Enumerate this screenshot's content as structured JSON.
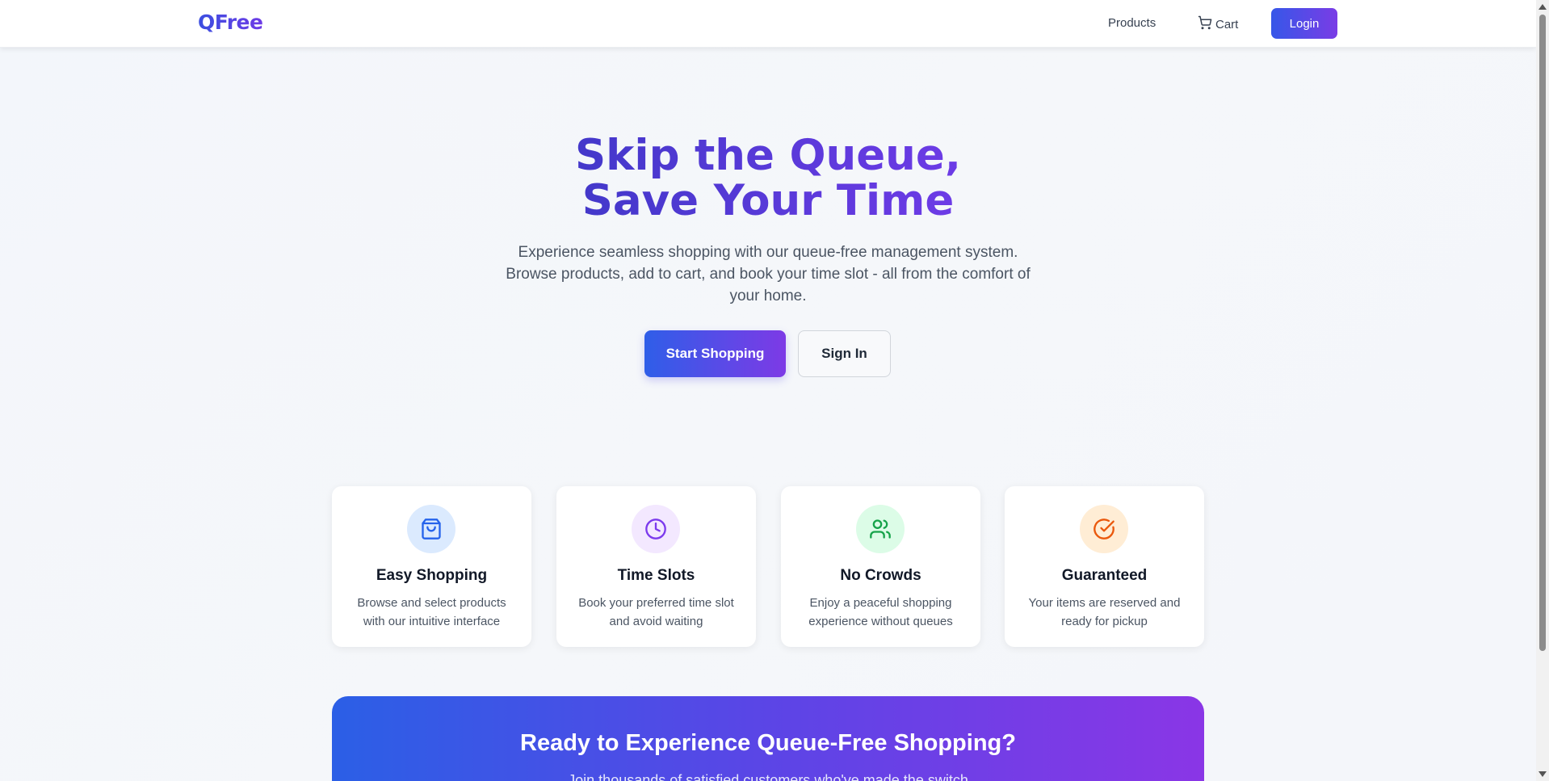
{
  "nav": {
    "logo": "QFree",
    "products": "Products",
    "cart": "Cart",
    "login": "Login"
  },
  "hero": {
    "title_line1": "Skip the Queue,",
    "title_line2": "Save Your Time",
    "subtitle": "Experience seamless shopping with our queue-free management system. Browse products, add to cart, and book your time slot - all from the comfort of your home.",
    "primary_button": "Start Shopping",
    "secondary_button": "Sign In"
  },
  "features": [
    {
      "icon": "shopping-bag-icon",
      "title": "Easy Shopping",
      "description": "Browse and select products with our intuitive interface",
      "icon_color": "#2563eb",
      "icon_bg": "#dbeafe"
    },
    {
      "icon": "clock-icon",
      "title": "Time Slots",
      "description": "Book your preferred time slot and avoid waiting",
      "icon_color": "#7c3aed",
      "icon_bg": "#f3e8ff"
    },
    {
      "icon": "users-icon",
      "title": "No Crowds",
      "description": "Enjoy a peaceful shopping experience without queues",
      "icon_color": "#16a34a",
      "icon_bg": "#dcfce7"
    },
    {
      "icon": "check-circle-icon",
      "title": "Guaranteed",
      "description": "Your items are reserved and ready for pickup",
      "icon_color": "#ea580c",
      "icon_bg": "#ffedd5"
    }
  ],
  "cta": {
    "title": "Ready to Experience Queue-Free Shopping?",
    "subtitle": "Join thousands of satisfied customers who've made the switch"
  },
  "colors": {
    "brand_start": "#3657e8",
    "brand_end": "#7a3ce6"
  }
}
